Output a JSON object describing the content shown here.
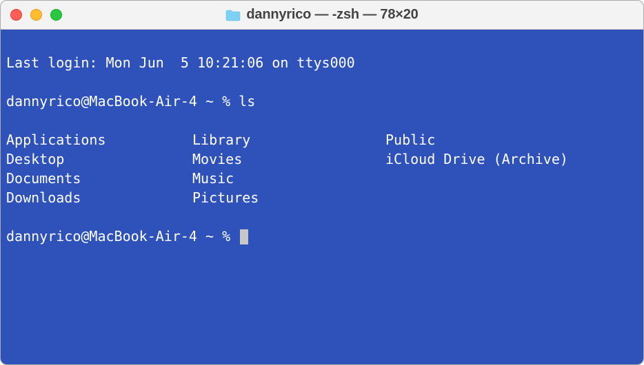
{
  "titlebar": {
    "title": "dannyrico — -zsh — 78×20"
  },
  "terminal": {
    "last_login": "Last login: Mon Jun  5 10:21:06 on ttys000",
    "prompt1": "dannyrico@MacBook-Air-4 ~ % ",
    "command1": "ls",
    "ls_columns": {
      "c1": [
        "Applications",
        "Desktop",
        "Documents",
        "Downloads"
      ],
      "c2": [
        "Library",
        "Movies",
        "Music",
        "Pictures"
      ],
      "c3": [
        "Public",
        "iCloud Drive (Archive)",
        "",
        ""
      ]
    },
    "prompt2": "dannyrico@MacBook-Air-4 ~ % "
  }
}
